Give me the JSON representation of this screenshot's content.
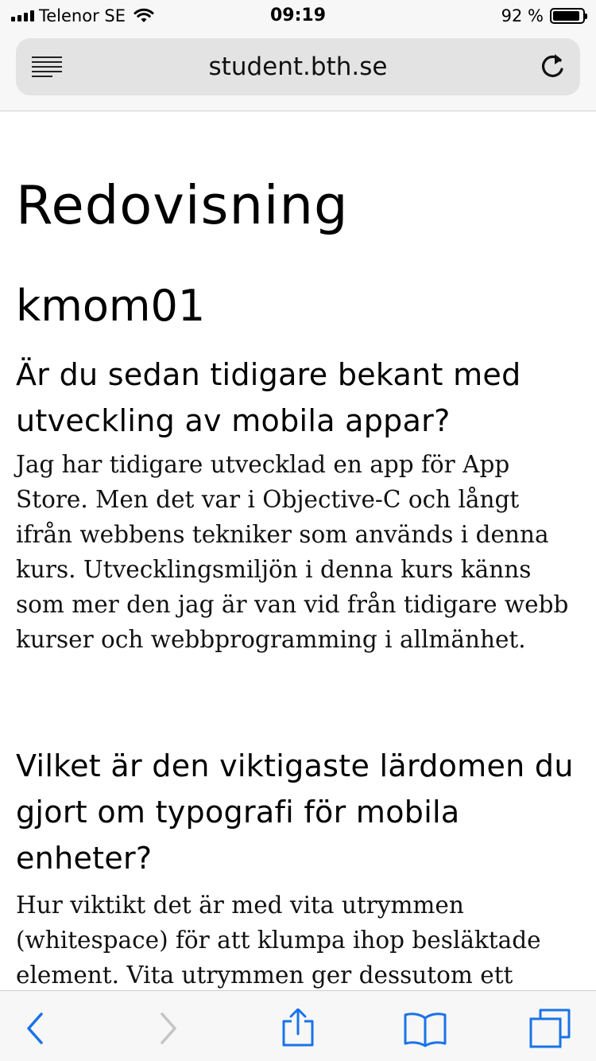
{
  "status_bar": {
    "carrier": "Telenor SE",
    "time": "09:19",
    "battery_percent_label": "92 %",
    "battery_level": 0.92
  },
  "browser": {
    "url": "student.bth.se"
  },
  "content": {
    "page_title": "Redovisning",
    "section_title": "kmom01",
    "questions": [
      {
        "question": "Är du sedan tidigare bekant med utveckling av mobila appar?",
        "answer": "Jag har tidigare utvecklad en app för App Store. Men det var i Objective-C och långt ifrån webbens tekniker som används i denna kurs. Utvecklingsmiljön i denna kurs känns som mer den jag är van vid från tidigare webb kurser och webbprogramming i allmänhet."
      },
      {
        "question": "Vilket är den viktigaste lärdomen du gjort om typografi för mobila enheter?",
        "answer": "Hur viktikt det är med vita utrymmen (whitespace) för att klumpa ihop besläktade element. Vita utrymmen ger dessutom ett"
      }
    ]
  },
  "toolbar": {
    "icons": [
      "back-icon",
      "forward-icon",
      "share-icon",
      "bookmarks-icon",
      "tabs-icon"
    ]
  },
  "colors": {
    "accent": "#1a73e8",
    "disabled": "#c4c4c8",
    "bar_background": "#f7f7f7",
    "url_field": "#e3e3e4"
  }
}
